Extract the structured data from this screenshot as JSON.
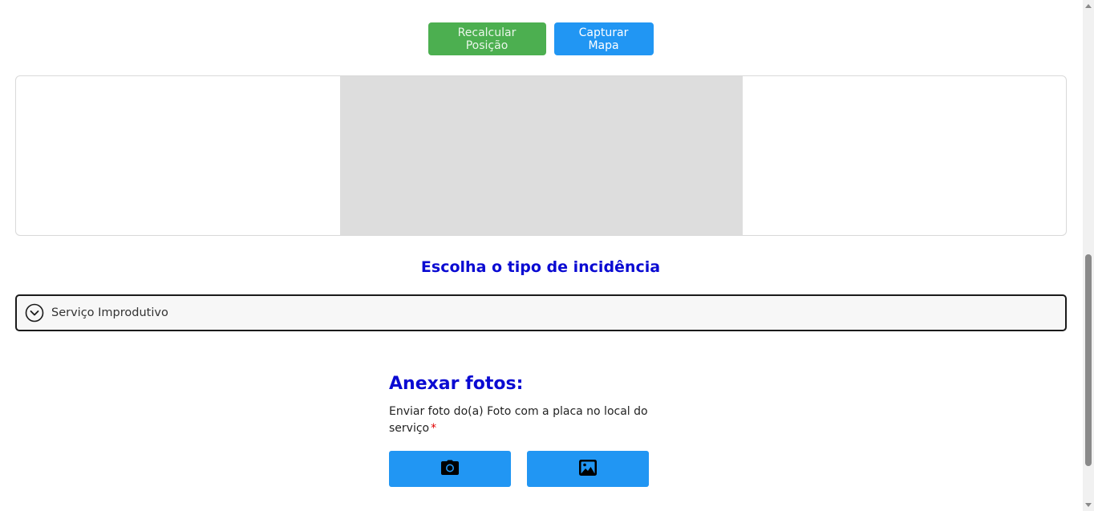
{
  "toolbar": {
    "recalculate_label": "Recalcular Posição",
    "capture_map_label": "Capturar Mapa"
  },
  "incidence": {
    "title": "Escolha o tipo de incidência",
    "selected_type": "Serviço Improdutivo"
  },
  "attachments": {
    "title": "Anexar fotos:",
    "description": "Enviar foto do(a) Foto com a placa no local do serviço",
    "required_marker": "*",
    "camera_icon": "camera-icon",
    "gallery_icon": "image-icon"
  },
  "colors": {
    "green_button": "#4caf50",
    "blue_button": "#2196f3",
    "title_blue": "#0a0ad2",
    "map_placeholder": "#dddddd"
  }
}
